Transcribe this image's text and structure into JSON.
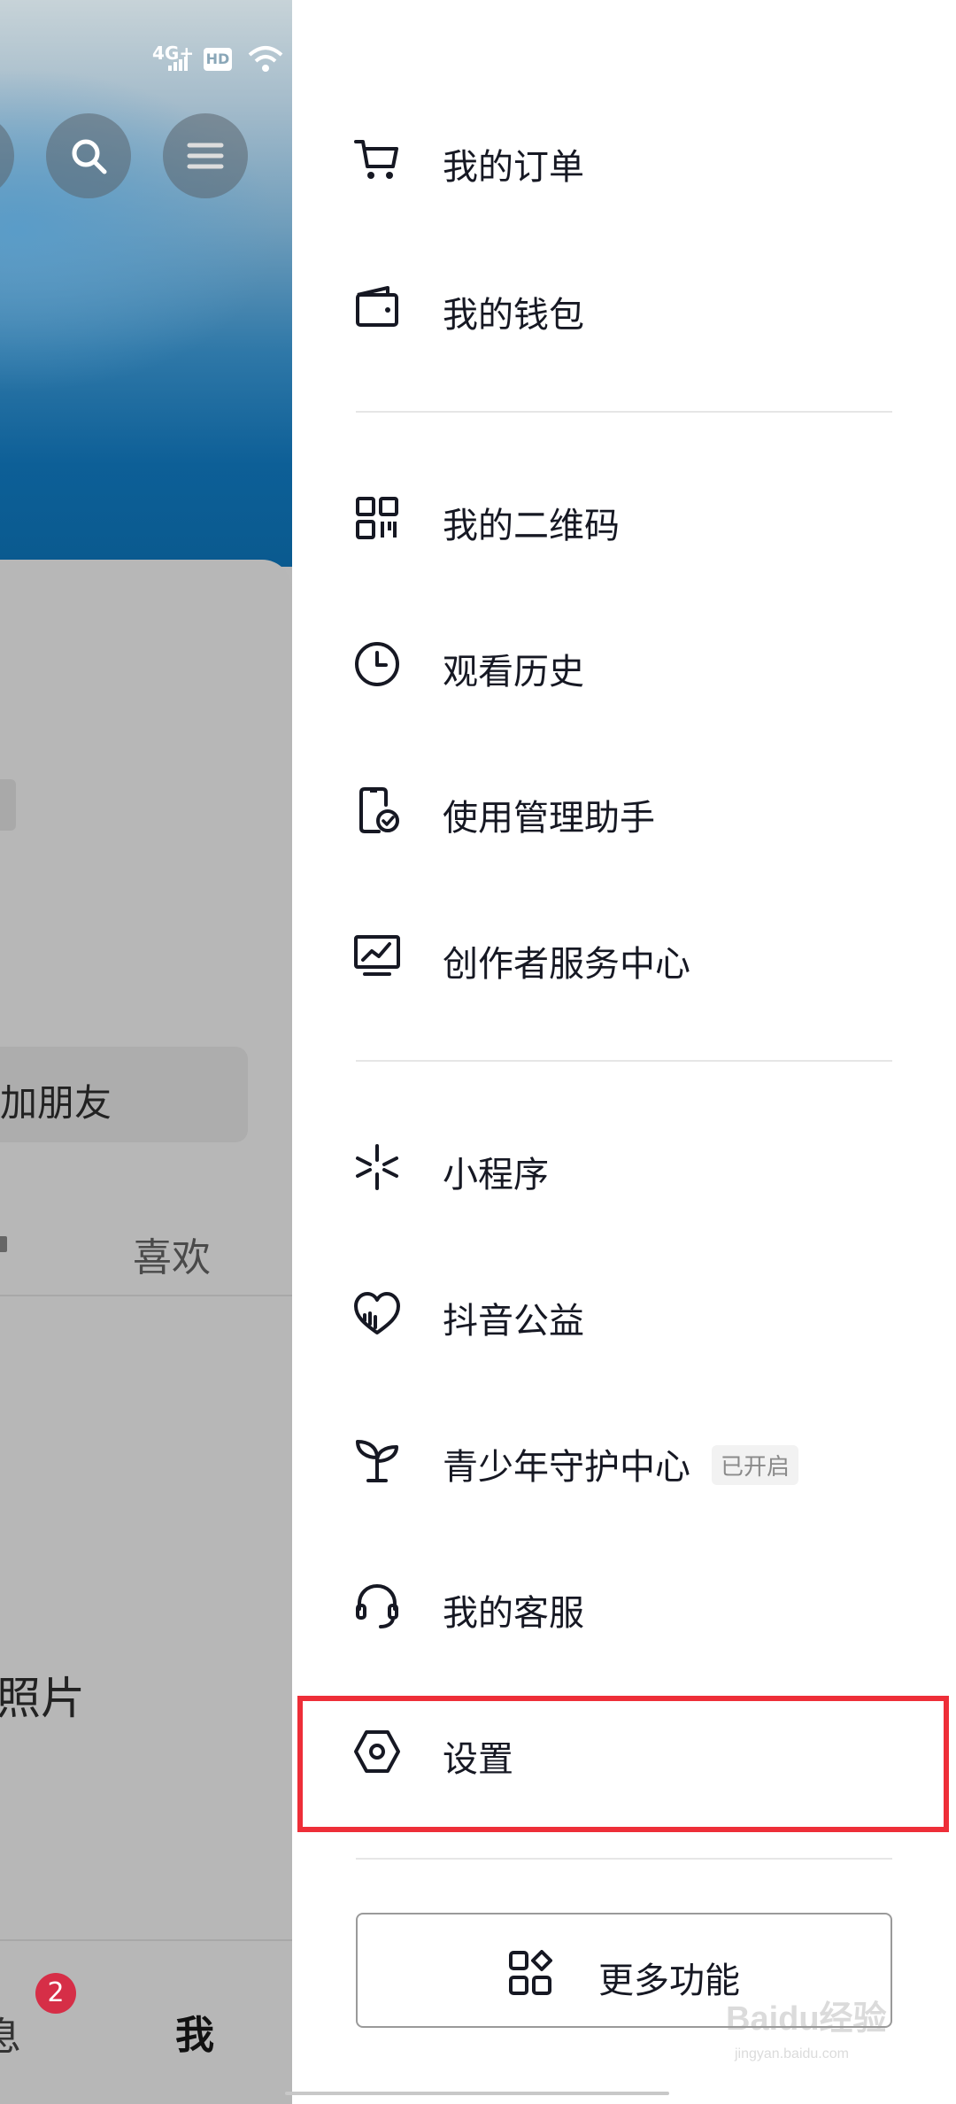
{
  "status_bar": {
    "network": "4G+",
    "hd": "HD"
  },
  "left_page": {
    "add_friend_label": "加朋友",
    "tab_likes_label": "喜欢",
    "photo_label": "照片",
    "nav_messages_label": "息",
    "nav_messages_badge": "2",
    "nav_me_label": "我"
  },
  "drawer": {
    "items": [
      {
        "label": "我的订单",
        "icon": "cart-icon"
      },
      {
        "label": "我的钱包",
        "icon": "wallet-icon"
      },
      {
        "label": "我的二维码",
        "icon": "qr-code-icon"
      },
      {
        "label": "观看历史",
        "icon": "clock-icon"
      },
      {
        "label": "使用管理助手",
        "icon": "phone-check-icon"
      },
      {
        "label": "创作者服务中心",
        "icon": "monitor-chart-icon"
      },
      {
        "label": "小程序",
        "icon": "mini-program-icon"
      },
      {
        "label": "抖音公益",
        "icon": "heart-charity-icon"
      },
      {
        "label": "青少年守护中心",
        "icon": "sprout-icon",
        "tag": "已开启"
      },
      {
        "label": "我的客服",
        "icon": "headset-icon"
      },
      {
        "label": "设置",
        "icon": "settings-hexagon-icon"
      }
    ],
    "more_label": "更多功能",
    "highlight_color": "#ee2e38"
  },
  "watermark": {
    "text": "Baidu经验",
    "sub": "jingyan.baidu.com"
  }
}
